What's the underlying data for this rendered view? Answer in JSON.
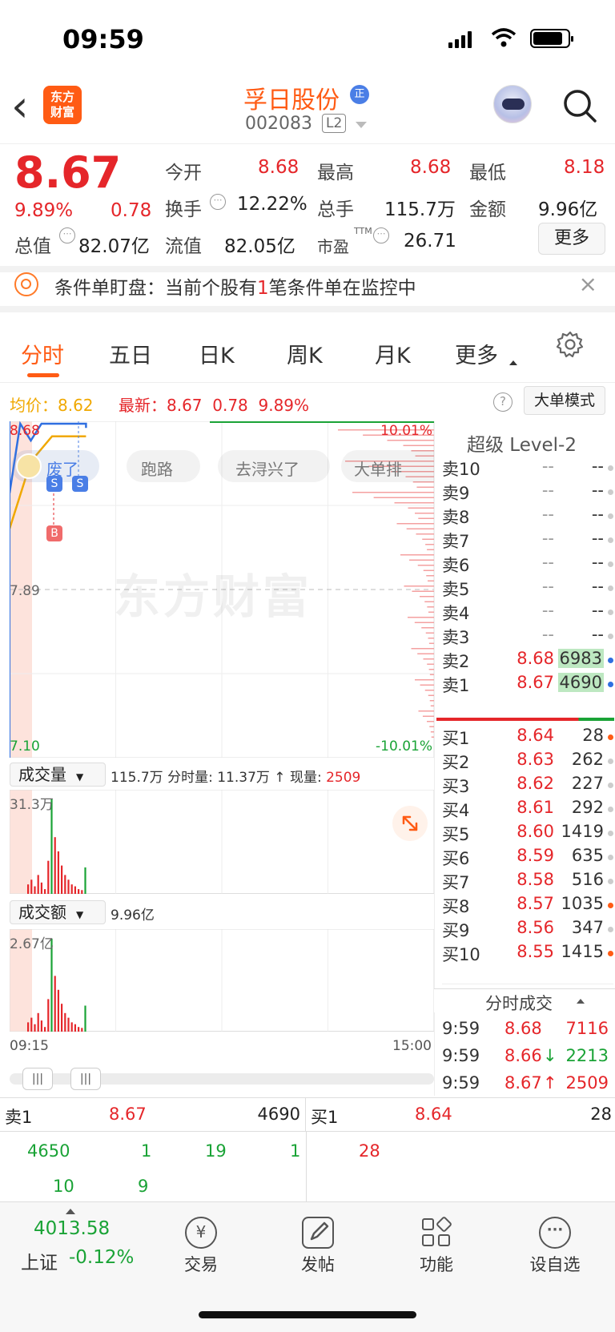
{
  "status_bar": {
    "time": "09:59"
  },
  "header": {
    "back": "‹",
    "logo_line1": "东方",
    "logo_line2": "财富",
    "stock_name": "孚日股份",
    "stock_code": "002083",
    "l2_badge": "L2",
    "zheng_badge": "正"
  },
  "quote": {
    "price": "8.67",
    "pct": "9.89%",
    "change": "0.78",
    "open_label": "今开",
    "open": "8.68",
    "high_label": "最高",
    "high": "8.68",
    "low_label": "最低",
    "low": "8.18",
    "turnover_label": "换手",
    "turnover": "12.22%",
    "volume_label": "总手",
    "volume": "115.7万",
    "amount_label": "金额",
    "amount": "9.96亿",
    "mcap_label": "总值",
    "mcap": "82.07亿",
    "float_label": "流值",
    "float": "82.05亿",
    "pe_label": "市盈",
    "pe_sup": "TTM",
    "pe": "26.71",
    "more": "更多"
  },
  "notice": {
    "prefix": "条件单盯盘：当前个股有",
    "count": "1",
    "suffix": "笔条件单在监控中",
    "close": "×"
  },
  "tabs": [
    {
      "label": "分时",
      "active": true
    },
    {
      "label": "五日"
    },
    {
      "label": "日K"
    },
    {
      "label": "周K"
    },
    {
      "label": "月K"
    },
    {
      "label": "更多"
    }
  ],
  "chart_info": {
    "avg_label": "均价：",
    "avg": "8.62",
    "latest_label": "最新：",
    "latest": "8.67",
    "chg": "0.78",
    "pct": "9.89%",
    "mode_button": "大单模式"
  },
  "chart_data": {
    "type": "line",
    "y_max_label": "8.68",
    "y_mid_label": "7.89",
    "y_min_label": "7.10",
    "pct_max_label": "10.01%",
    "pct_min_label": "-10.01%",
    "ylim": [
      7.1,
      8.68
    ],
    "price_series": [
      {
        "t": 0,
        "v": 8.35
      },
      {
        "t": 1,
        "v": 8.68
      },
      {
        "t": 2,
        "v": 8.6
      },
      {
        "t": 3,
        "v": 8.68
      },
      {
        "t": 8,
        "v": 8.68
      },
      {
        "t": 10,
        "v": 8.66
      },
      {
        "t": 12,
        "v": 8.68
      },
      {
        "t": 18,
        "v": 8.67
      }
    ],
    "avg_series": [
      {
        "t": 0,
        "v": 8.18
      },
      {
        "t": 2,
        "v": 8.5
      },
      {
        "t": 4,
        "v": 8.62
      },
      {
        "t": 18,
        "v": 8.62
      }
    ],
    "x_start": "09:15",
    "x_end": "15:00",
    "watermark": "东方财富",
    "bullets": [
      "废了",
      "跑路",
      "去浔兴了",
      "大单排"
    ],
    "markers": [
      "S",
      "S",
      "B"
    ],
    "volume_panel": {
      "label": "成交量",
      "total": "115.7万",
      "min_label": "分时量:",
      "min_value": "11.37万",
      "now_label": "现量:",
      "now_value": "2509",
      "ymax": "31.3万"
    },
    "amount_panel": {
      "label": "成交额",
      "total": "9.96亿",
      "ymax": "2.67亿"
    },
    "vol_bars": [
      0.1,
      0.15,
      0.08,
      0.2,
      0.12,
      0.05,
      0.35,
      1.0,
      0.6,
      0.45,
      0.3,
      0.2,
      0.15,
      0.1,
      0.08,
      0.05,
      0.04,
      0.28
    ]
  },
  "level2": {
    "title": "超级 Level-2",
    "asks": [
      {
        "l": "卖10",
        "p": "--",
        "v": "--"
      },
      {
        "l": "卖9",
        "p": "--",
        "v": "--"
      },
      {
        "l": "卖8",
        "p": "--",
        "v": "--"
      },
      {
        "l": "卖7",
        "p": "--",
        "v": "--"
      },
      {
        "l": "卖6",
        "p": "--",
        "v": "--"
      },
      {
        "l": "卖5",
        "p": "--",
        "v": "--"
      },
      {
        "l": "卖4",
        "p": "--",
        "v": "--"
      },
      {
        "l": "卖3",
        "p": "--",
        "v": "--"
      },
      {
        "l": "卖2",
        "p": "8.68",
        "v": "6983"
      },
      {
        "l": "卖1",
        "p": "8.67",
        "v": "4690"
      }
    ],
    "bids": [
      {
        "l": "买1",
        "p": "8.64",
        "v": "28"
      },
      {
        "l": "买2",
        "p": "8.63",
        "v": "262"
      },
      {
        "l": "买3",
        "p": "8.62",
        "v": "227"
      },
      {
        "l": "买4",
        "p": "8.61",
        "v": "292"
      },
      {
        "l": "买5",
        "p": "8.60",
        "v": "1419"
      },
      {
        "l": "买6",
        "p": "8.59",
        "v": "635"
      },
      {
        "l": "买7",
        "p": "8.58",
        "v": "516"
      },
      {
        "l": "买8",
        "p": "8.57",
        "v": "1035"
      },
      {
        "l": "买9",
        "p": "8.56",
        "v": "347"
      },
      {
        "l": "买10",
        "p": "8.55",
        "v": "1415"
      }
    ],
    "trades_title": "分时成交",
    "trades": [
      {
        "t": "9:59",
        "p": "8.68",
        "v": "7116",
        "arrow": ""
      },
      {
        "t": "9:59",
        "p": "8.66",
        "v": "2213",
        "arrow": "↓"
      },
      {
        "t": "9:59",
        "p": "8.67",
        "v": "2509",
        "arrow": "↑"
      }
    ]
  },
  "queue": {
    "sell_label": "卖1",
    "sell_price": "8.67",
    "sell_vol": "4690",
    "buy_label": "买1",
    "buy_price": "8.64",
    "buy_vol": "28",
    "sell_orders": [
      "4650",
      "1",
      "19",
      "1",
      "10",
      "9"
    ],
    "buy_orders": [
      "28"
    ]
  },
  "bottom_nav": {
    "index_value": "4013.58",
    "index_name": "上证",
    "index_pct": "-0.12%",
    "items": [
      "交易",
      "发帖",
      "功能",
      "设自选"
    ]
  },
  "colors": {
    "up": "#e5262a",
    "down": "#1aa336",
    "accent": "#ff5b14"
  }
}
